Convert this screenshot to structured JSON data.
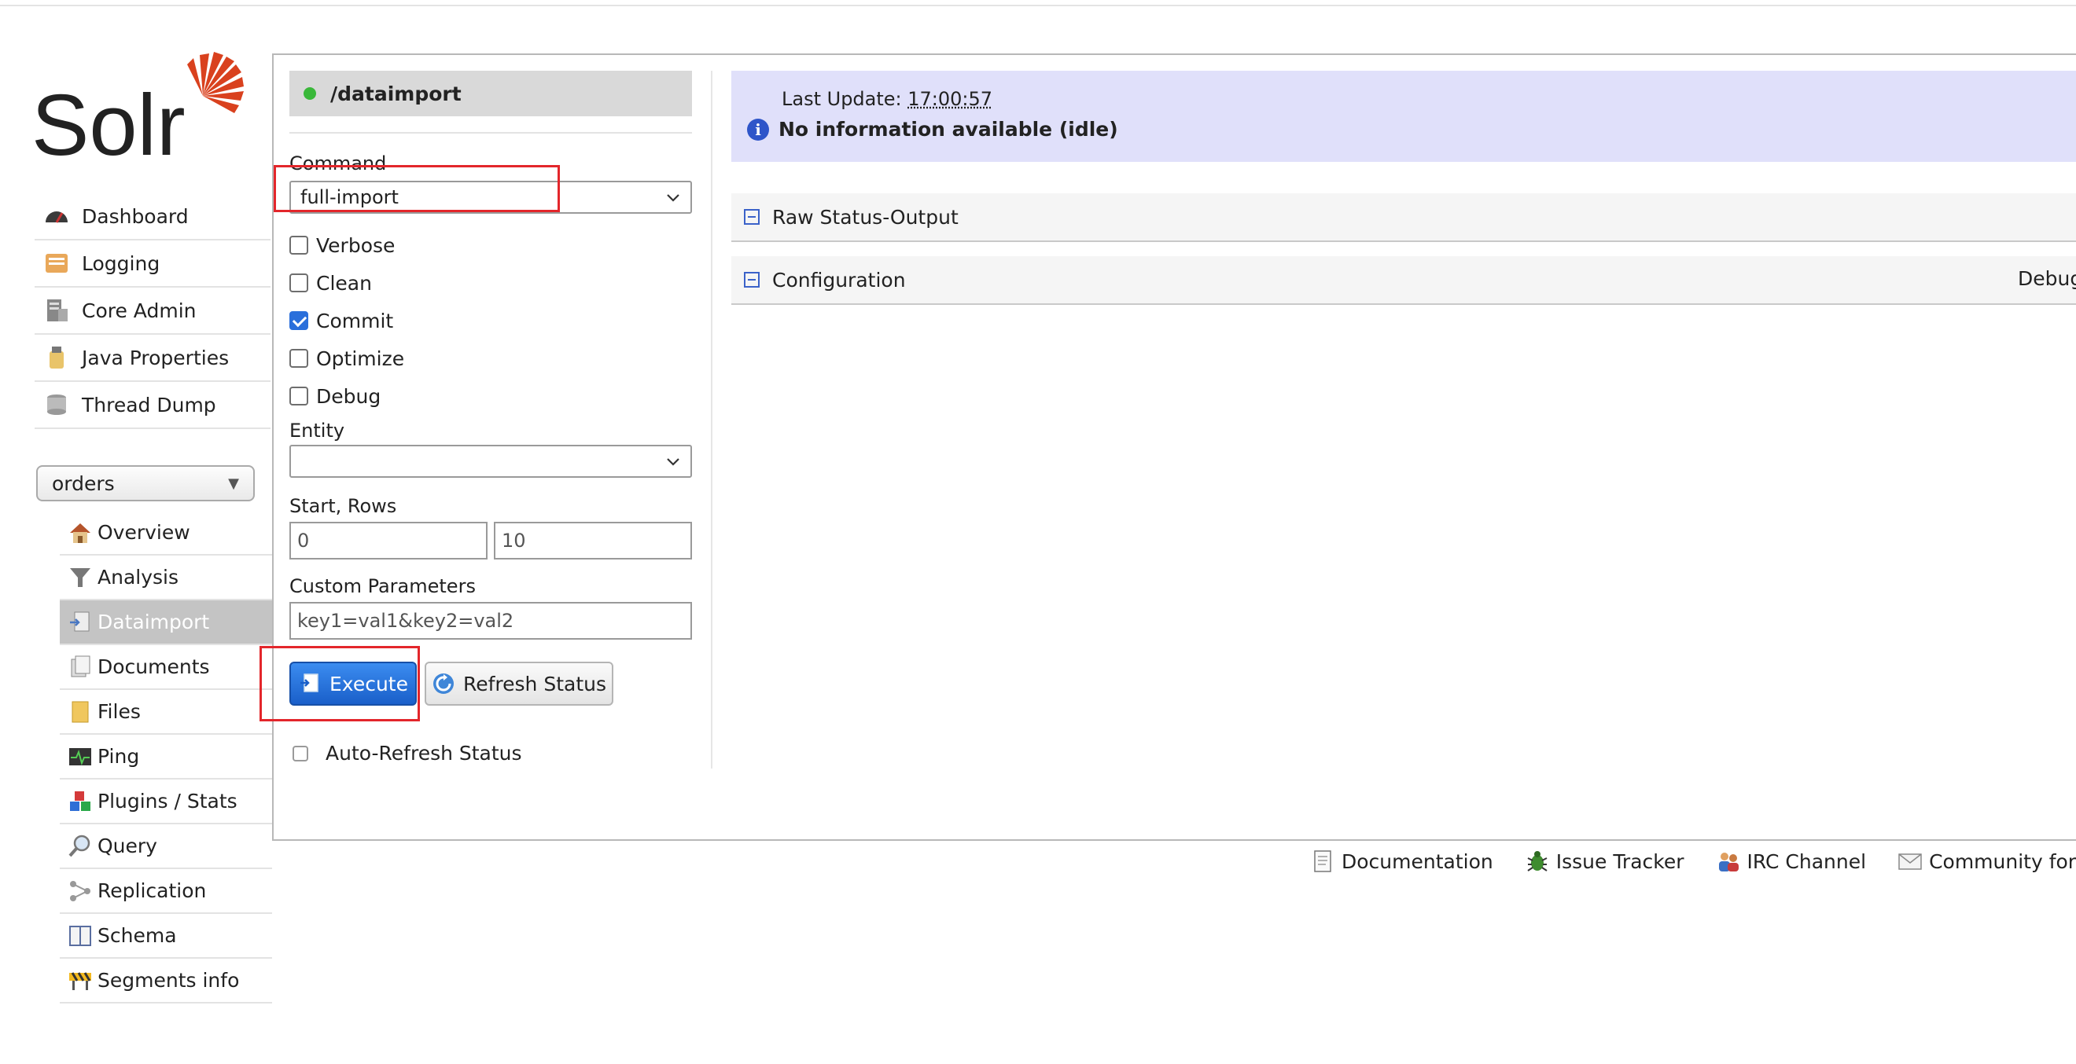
{
  "logo": {
    "text": "Solr"
  },
  "nav": [
    {
      "label": "Dashboard",
      "icon": "dashboard-icon"
    },
    {
      "label": "Logging",
      "icon": "logging-icon"
    },
    {
      "label": "Core Admin",
      "icon": "core-admin-icon"
    },
    {
      "label": "Java Properties",
      "icon": "java-properties-icon"
    },
    {
      "label": "Thread Dump",
      "icon": "thread-dump-icon"
    }
  ],
  "core_selector": {
    "value": "orders"
  },
  "core_nav": [
    {
      "label": "Overview",
      "icon": "home-icon"
    },
    {
      "label": "Analysis",
      "icon": "funnel-icon"
    },
    {
      "label": "Dataimport",
      "icon": "dataimport-icon",
      "active": true
    },
    {
      "label": "Documents",
      "icon": "documents-icon"
    },
    {
      "label": "Files",
      "icon": "folder-icon"
    },
    {
      "label": "Ping",
      "icon": "ping-icon"
    },
    {
      "label": "Plugins / Stats",
      "icon": "plugins-icon"
    },
    {
      "label": "Query",
      "icon": "query-icon"
    },
    {
      "label": "Replication",
      "icon": "replication-icon"
    },
    {
      "label": "Schema",
      "icon": "schema-icon"
    },
    {
      "label": "Segments info",
      "icon": "segments-icon"
    }
  ],
  "form": {
    "handler": "/dataimport",
    "command_label": "Command",
    "command_value": "full-import",
    "options": [
      {
        "label": "Verbose",
        "checked": false
      },
      {
        "label": "Clean",
        "checked": false
      },
      {
        "label": "Commit",
        "checked": true
      },
      {
        "label": "Optimize",
        "checked": false
      },
      {
        "label": "Debug",
        "checked": false
      }
    ],
    "entity_label": "Entity",
    "entity_value": "",
    "start_rows_label": "Start, Rows",
    "start_value": "0",
    "rows_value": "10",
    "custom_params_label": "Custom Parameters",
    "custom_params_value": "key1=val1&key2=val2",
    "execute_label": "Execute",
    "refresh_label": "Refresh Status",
    "auto_refresh_label": "Auto-Refresh Status",
    "auto_refresh_checked": false
  },
  "status": {
    "last_update_label": "Last Update:",
    "last_update_time": "17:00:57",
    "message": "No information available (idle)"
  },
  "sections": {
    "raw_status": "Raw Status-Output",
    "configuration": "Configuration",
    "debug_label": "Debug-Mode"
  },
  "footer": [
    {
      "label": "Documentation",
      "icon": "documentation-icon"
    },
    {
      "label": "Issue Tracker",
      "icon": "bug-icon"
    },
    {
      "label": "IRC Channel",
      "icon": "irc-icon"
    },
    {
      "label": "Community forum",
      "icon": "mail-icon"
    }
  ],
  "colors": {
    "accent": "#d9411e",
    "execute": "#1a5fc9",
    "annotation": "#e3262b",
    "info_bg": "#e0e0fa"
  }
}
